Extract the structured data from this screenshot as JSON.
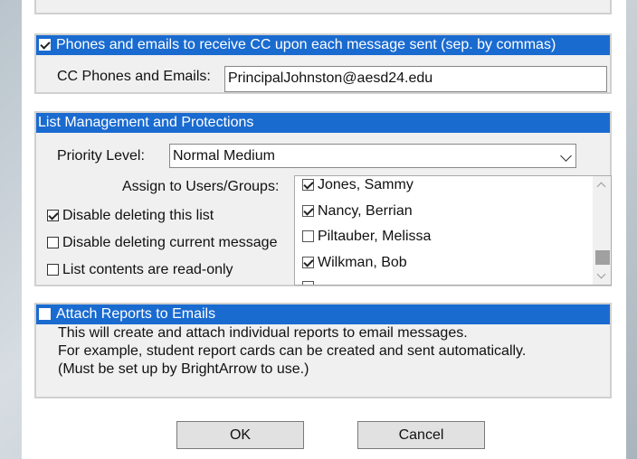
{
  "cc_section": {
    "header": "Phones and emails to receive CC upon each message sent (sep. by commas)",
    "checked": true,
    "field_label": "CC Phones and Emails:",
    "field_value": "PrincipalJohnston@aesd24.edu"
  },
  "list_section": {
    "header": "List Management and Protections",
    "priority_label": "Priority Level:",
    "priority_value": "Normal Medium",
    "assign_label": "Assign to Users/Groups:",
    "options": [
      {
        "label": "Disable deleting this list",
        "checked": true
      },
      {
        "label": "Disable deleting current message",
        "checked": false
      },
      {
        "label": "List contents are read-only",
        "checked": false
      }
    ],
    "users": [
      {
        "name": "Jones, Sammy",
        "checked": true
      },
      {
        "name": "Nancy, Berrian",
        "checked": true
      },
      {
        "name": "Piltauber, Melissa",
        "checked": false
      },
      {
        "name": "Wilkman, Bob",
        "checked": true
      }
    ]
  },
  "reports_section": {
    "header": "Attach Reports to Emails",
    "checked": false,
    "lines": [
      "This will create and attach individual reports to email messages.",
      "For example, student report cards can be created and sent automatically.",
      "(Must be set up by BrightArrow to use.)"
    ]
  },
  "buttons": {
    "ok": "OK",
    "cancel": "Cancel"
  }
}
